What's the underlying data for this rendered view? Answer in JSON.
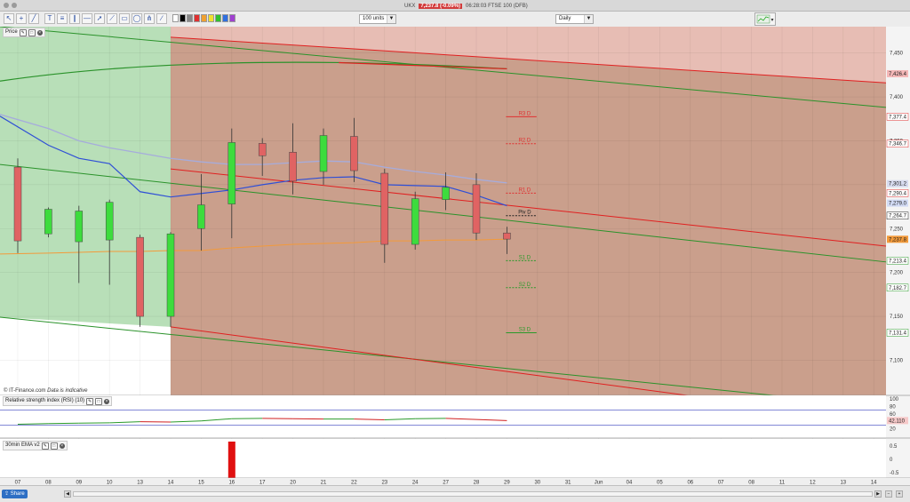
{
  "window": {
    "instrument": "UKX",
    "price_badge": "7,237.8 (-0.09%)",
    "detail": "06:28:03 FTSE 100 (DFB)"
  },
  "toolbar": {
    "units_select": "100 units",
    "interval_select": "Daily"
  },
  "panels": {
    "price_label": "Price",
    "rsi_label": "Relative strength index (RSI) (10)",
    "ema_label": "30min EMA v2"
  },
  "footer": {
    "copyright": "© IT-Finance.com",
    "disclaimer": "Data is indicative",
    "share_button": "Share"
  },
  "chart_data": {
    "type": "candlestick",
    "x_labels": [
      "07",
      "08",
      "09",
      "10",
      "13",
      "14",
      "15",
      "16",
      "17",
      "20",
      "21",
      "22",
      "23",
      "24",
      "27",
      "28",
      "29",
      "30",
      "31",
      "Jun",
      "04",
      "05",
      "06",
      "07",
      "08",
      "11",
      "12",
      "13",
      "14"
    ],
    "y_ticks": [
      "7,450",
      "7,400",
      "7,350",
      "7,300",
      "7,250",
      "7,200",
      "7,150",
      "7,100"
    ],
    "y_tick_values": [
      7450,
      7400,
      7350,
      7300,
      7250,
      7200,
      7150,
      7100
    ],
    "ylim": [
      7060,
      7480
    ],
    "candles": [
      {
        "o": 7320,
        "h": 7330,
        "l": 7222,
        "c": 7236
      },
      {
        "o": 7244,
        "h": 7274,
        "l": 7240,
        "c": 7272
      },
      {
        "o": 7235,
        "h": 7276,
        "l": 7188,
        "c": 7270
      },
      {
        "o": 7237,
        "h": 7283,
        "l": 7186,
        "c": 7280
      },
      {
        "o": 7240,
        "h": 7243,
        "l": 7138,
        "c": 7150
      },
      {
        "o": 7150,
        "h": 7246,
        "l": 7138,
        "c": 7244
      },
      {
        "o": 7250,
        "h": 7312,
        "l": 7225,
        "c": 7277
      },
      {
        "o": 7278,
        "h": 7364,
        "l": 7239,
        "c": 7348
      },
      {
        "o": 7347,
        "h": 7353,
        "l": 7310,
        "c": 7333
      },
      {
        "o": 7337,
        "h": 7370,
        "l": 7289,
        "c": 7304
      },
      {
        "o": 7315,
        "h": 7364,
        "l": 7300,
        "c": 7356
      },
      {
        "o": 7355,
        "h": 7376,
        "l": 7303,
        "c": 7316
      },
      {
        "o": 7313,
        "h": 7318,
        "l": 7211,
        "c": 7232
      },
      {
        "o": 7232,
        "h": 7292,
        "l": 7226,
        "c": 7284
      },
      {
        "o": 7283,
        "h": 7314,
        "l": 7271,
        "c": 7297
      },
      {
        "o": 7300,
        "h": 7313,
        "l": 7237,
        "c": 7245
      },
      {
        "o": 7245,
        "h": 7252,
        "l": 7221,
        "c": 7238
      }
    ],
    "ema_fast": [
      7378,
      7345,
      7330,
      7324,
      7292,
      7286,
      7290,
      7294,
      7300,
      7305,
      7308,
      7309,
      7300,
      7299,
      7298,
      7288,
      7276
    ],
    "ema_slow": [
      7380,
      7364,
      7350,
      7342,
      7336,
      7330,
      7326,
      7323,
      7323,
      7325,
      7327,
      7326,
      7320,
      7315,
      7311,
      7306,
      7302
    ],
    "ma_long": [
      7221,
      7222,
      7223,
      7224,
      7224,
      7225,
      7225,
      7228,
      7230,
      7232,
      7233,
      7234,
      7236,
      7236,
      7237,
      7237,
      7238
    ],
    "pivot_levels": [
      {
        "name": "R3 D",
        "value": 7377.4,
        "label": "7,377.4",
        "color": "#e03030",
        "style": "solid"
      },
      {
        "name": "R2 D",
        "value": 7346.7,
        "label": "7,346.7",
        "color": "#e03030",
        "style": "dashed"
      },
      {
        "name": "R1 D",
        "value": 7290.4,
        "label": "7,290.4",
        "color": "#e03030",
        "style": "dashed"
      },
      {
        "name": "Piv D",
        "value": 7264.7,
        "label": "7,264.7",
        "color": "#222222",
        "style": "dashed"
      },
      {
        "name": "S1 D",
        "value": 7213.4,
        "label": "7,213.4",
        "color": "#2a9a2a",
        "style": "dashed"
      },
      {
        "name": "S2 D",
        "value": 7182.7,
        "label": "7,182.7",
        "color": "#2a9a2a",
        "style": "dashed"
      },
      {
        "name": "S3 D",
        "value": 7131.4,
        "label": "7,131.4",
        "color": "#2a9a2a",
        "style": "solid"
      }
    ],
    "price_tags": [
      {
        "value": 7426.4,
        "label": "7,426.4",
        "color": "#f4b7b7"
      },
      {
        "value": 7301.2,
        "label": "7,301.2",
        "color": "#d7dbef"
      },
      {
        "value": 7279.0,
        "label": "7,279.0",
        "color": "#d2dbf5"
      },
      {
        "value": 7237.8,
        "label": "7,237.8",
        "color": "#f39a3a"
      }
    ],
    "rsi": {
      "ticks": [
        "100",
        "80",
        "60",
        "40",
        "20"
      ],
      "tick_values": [
        100,
        80,
        60,
        40,
        20
      ],
      "levels": [
        70,
        30
      ],
      "current_label": "42.110",
      "values": [
        32,
        34,
        35,
        36,
        39,
        38,
        41,
        47,
        48,
        47,
        46,
        46,
        44,
        47,
        48,
        45,
        42
      ]
    },
    "ema30_panel": {
      "ticks": [
        "0.5",
        "0",
        "-0.5"
      ],
      "tick_values": [
        0.5,
        0,
        -0.5
      ],
      "bar_index": 7
    },
    "colors": {
      "up": "#3ddc3d",
      "down": "#e06363",
      "ema_fast": "#2f4fd6",
      "ema_slow": "#a6acdc",
      "ma_long": "#f39a3a",
      "channel_red": "#e02020",
      "channel_green": "#2a922a"
    }
  }
}
